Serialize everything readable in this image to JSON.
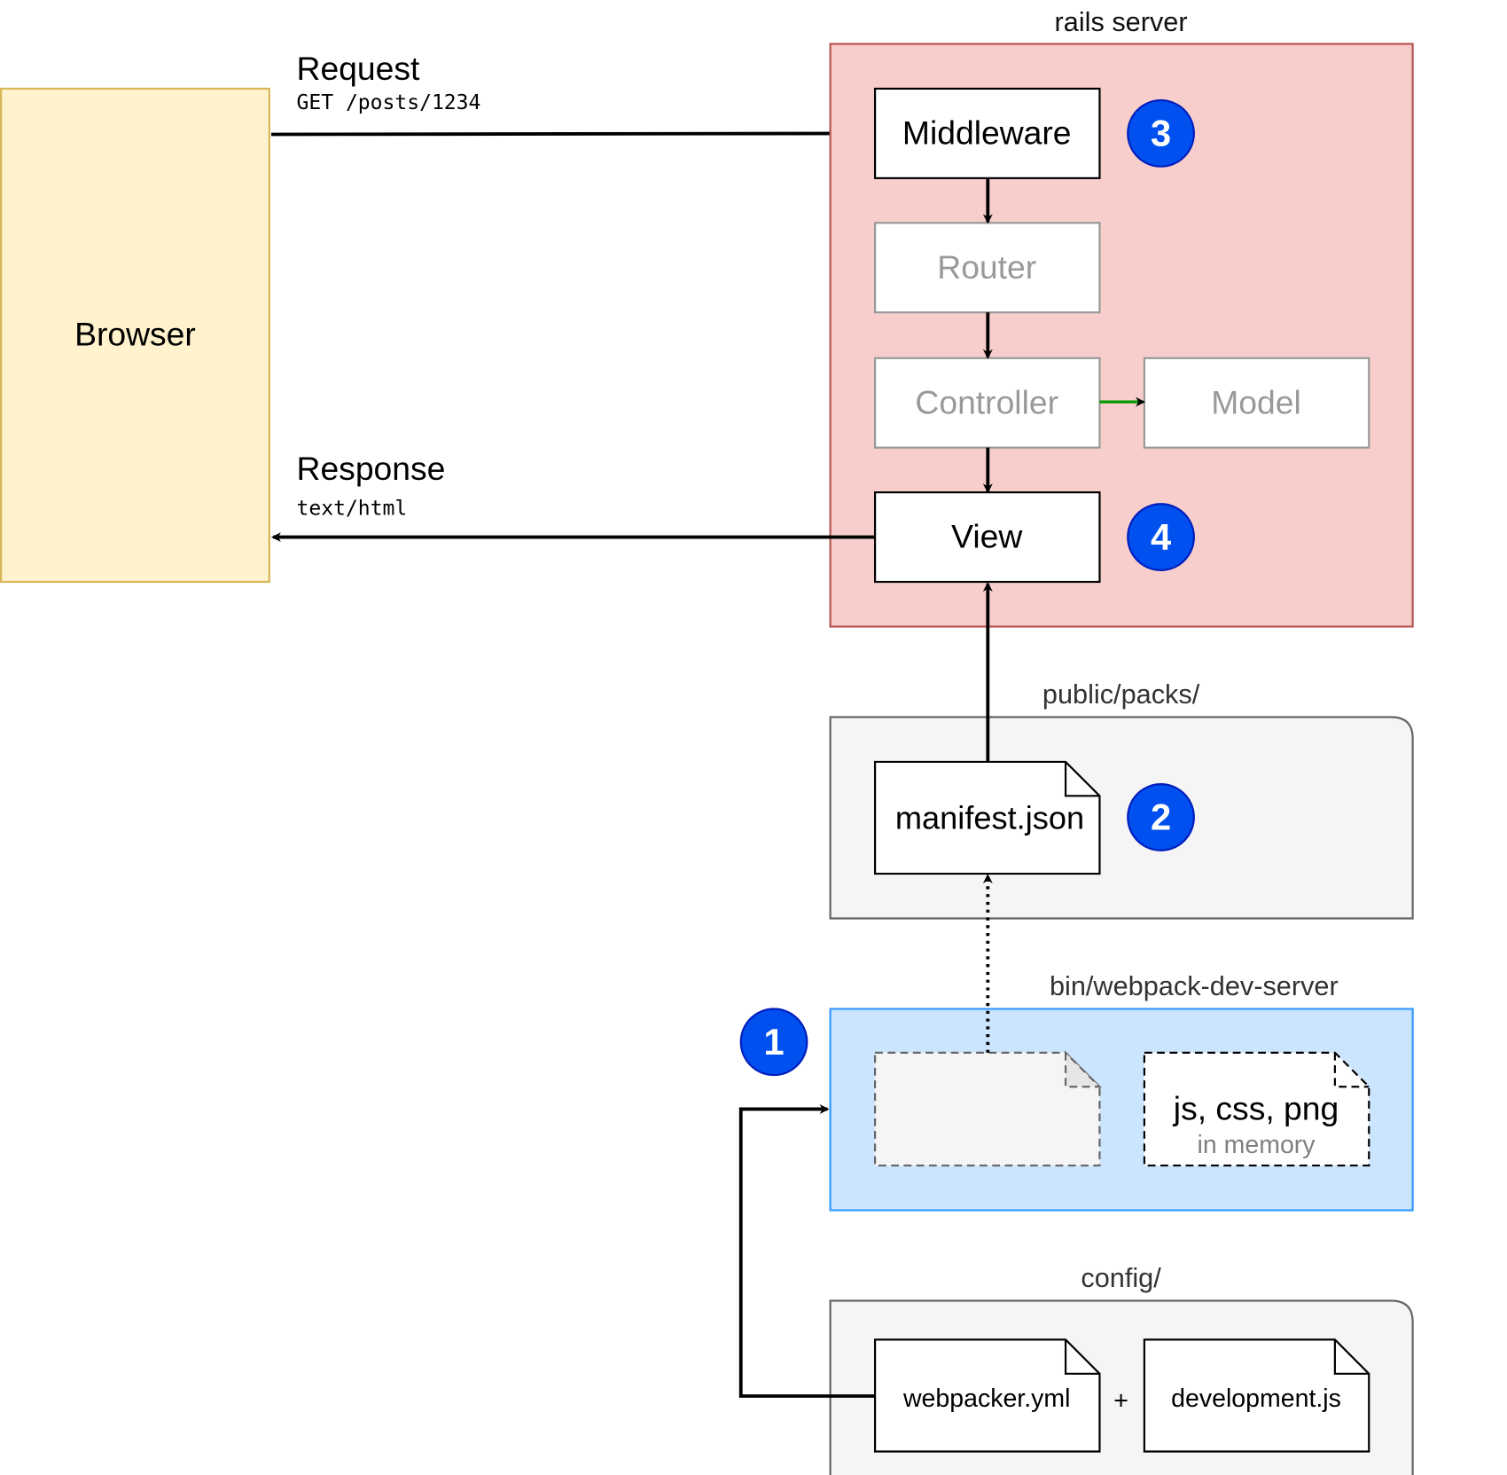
{
  "browser": {
    "label": "Browser"
  },
  "request": {
    "title": "Request",
    "detail": "GET /posts/1234"
  },
  "response": {
    "title": "Response",
    "detail": "text/html"
  },
  "rails_server": {
    "label": "rails server",
    "middleware": "Middleware",
    "router": "Router",
    "controller": "Controller",
    "model": "Model",
    "view": "View"
  },
  "public_packs": {
    "label": "public/packs/",
    "manifest": "manifest.json"
  },
  "webpack_dev_server": {
    "label": "bin/webpack-dev-server",
    "assets": "js, css, png",
    "assets_note": "in memory"
  },
  "config": {
    "label": "config/",
    "file1": "webpacker.yml",
    "plus": "+",
    "file2": "development.js"
  },
  "badges": [
    "1",
    "2",
    "3",
    "4"
  ],
  "colors": {
    "browser_fill": "#fff2cc",
    "browser_stroke": "#d6b656",
    "rails_fill": "#f8cecc",
    "rails_stroke": "#b85450",
    "group_fill": "#f5f5f5",
    "group_stroke": "#666666",
    "dev_server_fill": "#cce5ff",
    "dev_server_stroke": "#3399ff",
    "badge_fill": "#0050ef",
    "badge_stroke": "#001dbc",
    "model_arrow": "#009900"
  }
}
